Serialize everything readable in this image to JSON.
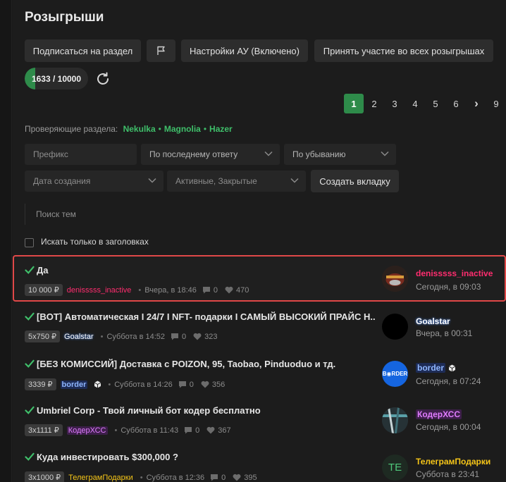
{
  "header": {
    "title": "Розыгрыши"
  },
  "toolbar": {
    "subscribe_label": "Подписаться на раздел",
    "au_settings_label": "Настройки АУ (Включено)",
    "join_all_label": "Принять участие во всех розыгрышах",
    "flag_icon": "flag-icon"
  },
  "progress": {
    "text": "1633 / 10000",
    "current": 1633,
    "total": 10000
  },
  "pagination": {
    "pages": [
      "1",
      "2",
      "3",
      "4",
      "5",
      "6",
      "›",
      "9"
    ],
    "active": "1"
  },
  "reviewers": {
    "label": "Проверяющие раздела:",
    "names": [
      "Nekulka",
      "Magnolia",
      "Hazer"
    ]
  },
  "filters": {
    "prefix_placeholder": "Префикс",
    "sort_by": "По последнему ответу",
    "order": "По убыванию",
    "date": "Дата создания",
    "status": "Активные, Закрытые",
    "create_tab_label": "Создать вкладку",
    "search_placeholder": "Поиск тем",
    "titles_only_label": "Искать только в заголовках"
  },
  "threads": [
    {
      "title": "Да",
      "prize": "10 000 ₽",
      "author": "denisssss_inactive",
      "author_color": "#ff2d6f",
      "created": "Вчера, в 18:46",
      "replies": "0",
      "likes": "470",
      "last_user": "denisssss_inactive",
      "last_user_color": "#ff2d6f",
      "last_time": "Сегодня, в 09:03",
      "highlight": true
    },
    {
      "title": "[BOT] Автоматическая I 24/7 I NFT- подарки I САМЫЙ ВЫСОКИЙ ПРАЙС Н...",
      "prize": "5x750 ₽",
      "author": "Goalstar",
      "author_color": "#ffffff",
      "created": "Суббота в 14:52",
      "replies": "0",
      "likes": "323",
      "last_user": "Goalstar",
      "last_user_color": "#ffffff",
      "last_time": "Вчера, в 00:31"
    },
    {
      "title": "[БЕЗ КОМИССИЙ] Доставка с POIZON, 95, Taobao, Pinduoduo и тд.",
      "prize": "3339 ₽",
      "author": "border",
      "author_color": "#8fb6ff",
      "created": "Суббота в 14:26",
      "replies": "0",
      "likes": "356",
      "last_user": "border",
      "last_user_color": "#8fb6ff",
      "last_time": "Сегодня, в 07:24",
      "avatar_text": "B◉RDER"
    },
    {
      "title": "Umbriel Corp - Твой личный бот кодер бесплатно",
      "prize": "3x1111 ₽",
      "author": "КодерХСС",
      "author_color": "#e07cff",
      "created": "Суббота в 11:43",
      "replies": "0",
      "likes": "367",
      "last_user": "КодерХСС",
      "last_user_color": "#e07cff",
      "last_time": "Сегодня, в 00:04"
    },
    {
      "title": "Куда инвестировать $300,000 ?",
      "prize": "3x1000 ₽",
      "author": "ТелеграмПодарки",
      "author_color": "#f5c518",
      "created": "Суббота в 12:36",
      "replies": "0",
      "likes": "395",
      "last_user": "ТелеграмПодарки",
      "last_user_color": "#f5c518",
      "last_time": "Суббота в 23:41",
      "avatar_text": "TE"
    }
  ],
  "colors": {
    "accent": "#2e8b4a",
    "highlight_border": "#e04848",
    "background": "#1c1c1c"
  }
}
